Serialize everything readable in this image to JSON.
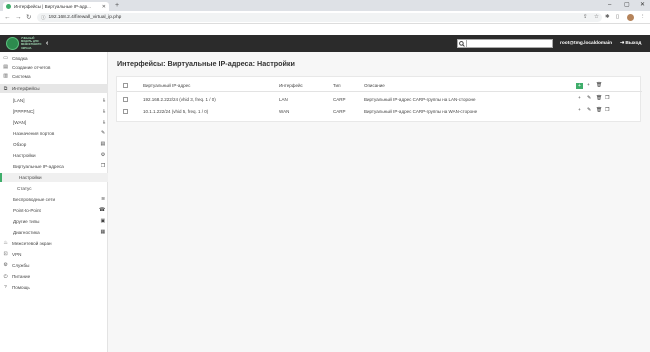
{
  "browser": {
    "tab_title": "Интерфейсы | Виртуальные IP-адр...",
    "url": "192.168.2.4/firewall_virtual_ip.php"
  },
  "header": {
    "logo_text": "УЧЕБНЫЙ МОДУЛЬ ДЛЯ МЕЖСЕТЕВОГО ЭКРАНА",
    "user": "root@tmg.localdomain",
    "logout": "Выход",
    "search_placeholder": ""
  },
  "sidebar": {
    "items": [
      {
        "label": "Сводка",
        "icon": "dashboard-icon"
      },
      {
        "label": "Создание отчетов",
        "icon": "report-icon"
      },
      {
        "label": "Система",
        "icon": "server-icon"
      },
      {
        "label": "Интерфейсы",
        "icon": "sitemap-icon"
      },
      {
        "label": "[LAN]",
        "icon": "network-icon"
      },
      {
        "label": "[PPPPNC]",
        "icon": "network-icon"
      },
      {
        "label": "[WAN]",
        "icon": "network-icon"
      },
      {
        "label": "Назначения портов",
        "icon": "pencil-icon"
      },
      {
        "label": "Обзор",
        "icon": "list-icon"
      },
      {
        "label": "Настройки",
        "icon": "cogs-icon"
      },
      {
        "label": "Виртуальные IP-адреса",
        "icon": "copy-icon"
      },
      {
        "label": "Настройки",
        "icon": ""
      },
      {
        "label": "Статус",
        "icon": ""
      },
      {
        "label": "Беспроводные сети",
        "icon": "wifi-icon"
      },
      {
        "label": "Point-to-Point",
        "icon": "phone-icon"
      },
      {
        "label": "Другие типы",
        "icon": "archive-icon"
      },
      {
        "label": "Диагностика",
        "icon": "medkit-icon"
      },
      {
        "label": "Межсетевой экран",
        "icon": "fire-icon"
      },
      {
        "label": "VPN",
        "icon": "lock-icon"
      },
      {
        "label": "Службы",
        "icon": "gear-icon"
      },
      {
        "label": "Питание",
        "icon": "plug-icon"
      },
      {
        "label": "Помощь",
        "icon": "help-icon"
      }
    ]
  },
  "main": {
    "title": "Интерфейсы: Виртуальные IP-адреса: Настройки",
    "columns": [
      "Виртуальный IP-адрес",
      "Интерфейс",
      "Тип",
      "Описание"
    ],
    "rows": [
      {
        "address": "192.168.2.222/24 (vhid 3, freq. 1 / 0)",
        "interface": "LAN",
        "type": "CARP",
        "description": "Виртуальный IP-адрес CARP-группы на LAN-стороне"
      },
      {
        "address": "10.1.1.222/24 (vhid 5, freq. 1 / 0)",
        "interface": "WAN",
        "type": "CARP",
        "description": "Виртуальный IP-адрес CARP-группы на WAN-стороне"
      }
    ]
  },
  "colors": {
    "accent": "#3fae6b",
    "header_bg": "#2b2b2b"
  }
}
